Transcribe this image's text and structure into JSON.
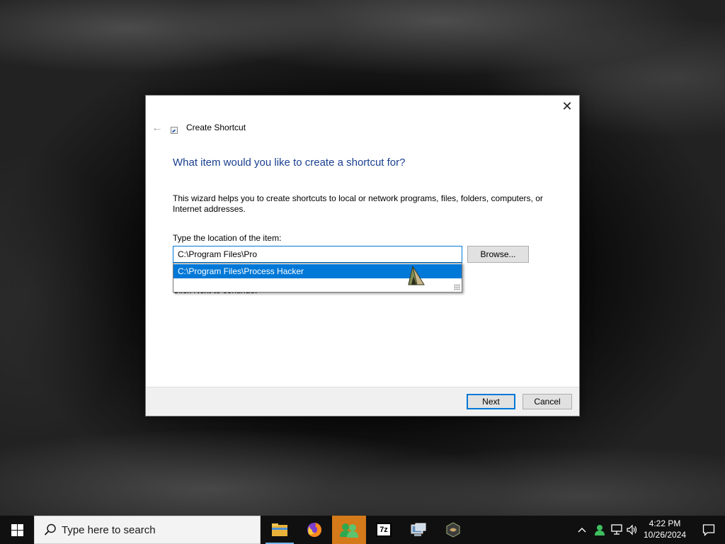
{
  "dialog": {
    "title": "Create Shortcut",
    "close_glyph": "✕",
    "back_glyph": "←",
    "heading": "What item would you like to create a shortcut for?",
    "description_lines": [
      "This wizard helps you to create shortcuts to local or network programs, files, folders, computers, or",
      "Internet addresses."
    ],
    "location_label": "Type the location of the item:",
    "location_value": "C:\\Program Files\\Pro",
    "browse_label": "Browse...",
    "hint_text": "Click Next to continue.",
    "autocomplete_items": [
      "C:\\Program Files\\Process Hacker"
    ],
    "next_label": "Next",
    "cancel_label": "Cancel"
  },
  "taskbar": {
    "search_placeholder": "Type here to search",
    "apps": [
      {
        "name": "file-explorer-icon",
        "state": "running"
      },
      {
        "name": "firefox-icon",
        "state": "normal"
      },
      {
        "name": "users-app-icon",
        "state": "focused"
      },
      {
        "name": "7zip-icon",
        "state": "normal",
        "label": "7z"
      },
      {
        "name": "network-app-icon",
        "state": "normal"
      },
      {
        "name": "ghidra-icon",
        "state": "normal"
      }
    ],
    "clock_time": "4:22 PM",
    "clock_date": "10/26/2024"
  },
  "colors": {
    "accent": "#0078d7",
    "heading": "#1a3f8f",
    "focused_app": "#d47a1a"
  }
}
